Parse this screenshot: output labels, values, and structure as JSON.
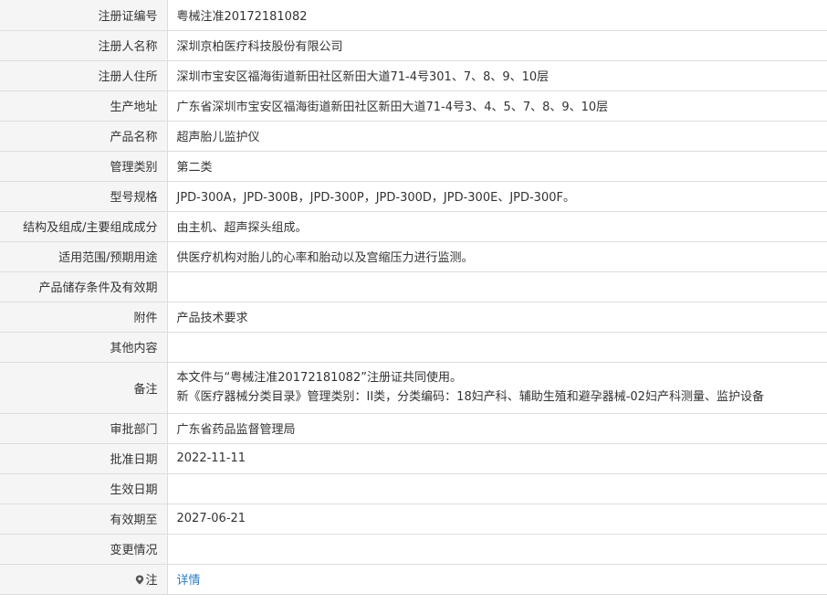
{
  "rows": [
    {
      "label": "注册证编号",
      "value": "粤械注准20172181082"
    },
    {
      "label": "注册人名称",
      "value": "深圳京柏医疗科技股份有限公司"
    },
    {
      "label": "注册人住所",
      "value": "深圳市宝安区福海街道新田社区新田大道71-4号301、7、8、9、10层"
    },
    {
      "label": "生产地址",
      "value": "广东省深圳市宝安区福海街道新田社区新田大道71-4号3、4、5、7、8、9、10层"
    },
    {
      "label": "产品名称",
      "value": "超声胎儿监护仪"
    },
    {
      "label": "管理类别",
      "value": "第二类"
    },
    {
      "label": "型号规格",
      "value": "JPD-300A，JPD-300B，JPD-300P，JPD-300D，JPD-300E、JPD-300F。"
    },
    {
      "label": "结构及组成/主要组成成分",
      "value": "由主机、超声探头组成。"
    },
    {
      "label": "适用范围/预期用途",
      "value": "供医疗机构对胎儿的心率和胎动以及宫缩压力进行监测。"
    },
    {
      "label": "产品储存条件及有效期",
      "value": ""
    },
    {
      "label": "附件",
      "value": "产品技术要求"
    },
    {
      "label": "其他内容",
      "value": ""
    },
    {
      "label": "备注",
      "lines": [
        "本文件与“粤械注准20172181082”注册证共同使用。",
        "新《医疗器械分类目录》管理类别：II类，分类编码：18妇产科、辅助生殖和避孕器械-02妇产科测量、监护设备"
      ]
    },
    {
      "label": "审批部门",
      "value": "广东省药品监督管理局"
    },
    {
      "label": "批准日期",
      "value": "2022-11-11"
    },
    {
      "label": "生效日期",
      "value": ""
    },
    {
      "label": "有效期至",
      "value": "2027-06-21"
    },
    {
      "label": "变更情况",
      "value": ""
    },
    {
      "label": "注",
      "icon": "map-pin-icon",
      "link": "详情"
    }
  ]
}
